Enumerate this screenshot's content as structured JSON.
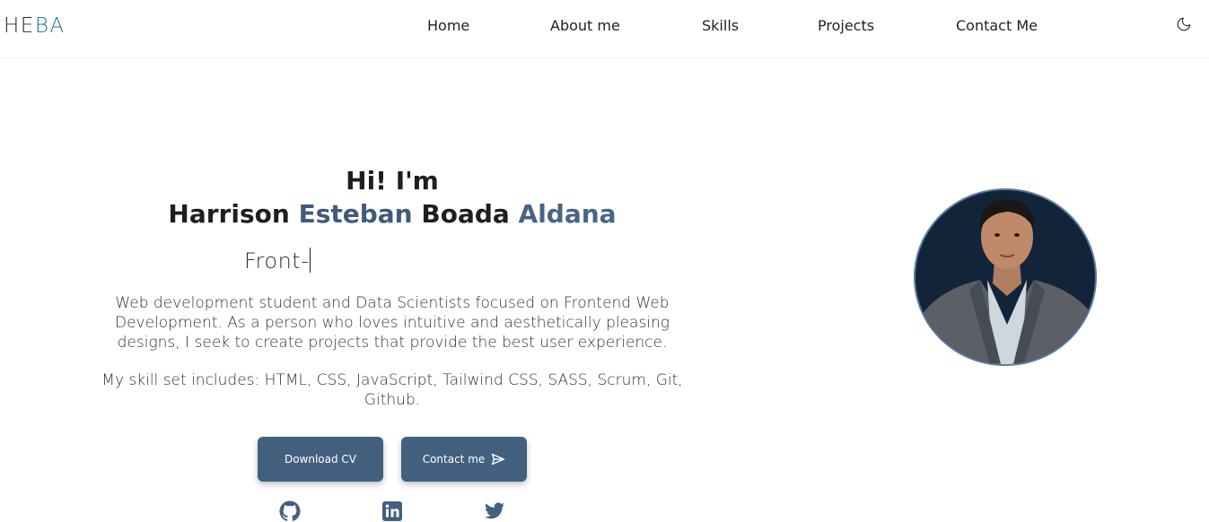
{
  "header": {
    "logo_part1": "HE",
    "logo_part2": "BA",
    "nav": [
      "Home",
      "About me",
      "Skills",
      "Projects",
      "Contact Me"
    ],
    "theme_icon": "moon-icon"
  },
  "hero": {
    "greeting": "Hi! I'm",
    "name_parts": [
      "Harrison",
      "Esteban",
      "Boada",
      "Aldana"
    ],
    "typed_text": "Front-",
    "description": "Web development student and Data Scientists focused on Frontend Web Development. As a person who loves intuitive and aesthetically pleasing designs, I seek to create projects that provide the best user experience.",
    "skills_text": "My skill set includes: HTML, CSS, JavaScript, Tailwind CSS, SASS, Scrum, Git, Github.",
    "buttons": {
      "download_cv": "Download CV",
      "contact_me": "Contact me"
    },
    "social_icons": [
      "github-icon",
      "linkedin-icon",
      "twitter-icon"
    ]
  },
  "colors": {
    "accent": "#43607f",
    "logo_accent": "#1f6d99",
    "avatar_bg": "#12243a"
  }
}
